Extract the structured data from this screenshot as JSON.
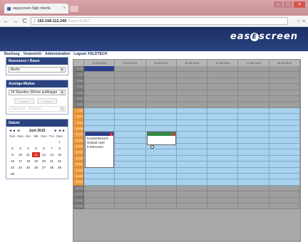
{
  "browser": {
    "tab_title": "easyscreen Sign Interfa",
    "tab_close": "×",
    "url_host": "192.168.112.240",
    "url_path": "/easyLEXEC",
    "win_min": "–",
    "win_max": "□",
    "win_close": "×",
    "back_icon": "←",
    "forward_icon": "→",
    "reload_icon": "C",
    "menu_icon": "☆ ≡"
  },
  "app": {
    "logo_left": "eas",
    "logo_badge": "E",
    "logo_right": "screen",
    "nav": [
      "Buchung",
      "Voransicht",
      "Administration",
      "Logout: FELDTECH"
    ]
  },
  "sidebar": {
    "resource": {
      "title": "Ressource / Raum",
      "value": "Berlin"
    },
    "display": {
      "title": "Anzeige-Modus",
      "value": "24 Stunden (60min aufklappe",
      "btn1": "Laden",
      "btn2": "Zurück",
      "secondary": "Standard - Wochen"
    },
    "date": {
      "title": "Datum",
      "prev": "◄◄ ◄",
      "month": "Juni 2015",
      "next": "► ►►",
      "weekdays": [
        "Son",
        "Mon",
        "Die",
        "Mit",
        "Don",
        "Fre",
        "Sam"
      ],
      "days": [
        "",
        "",
        "",
        "",
        "",
        "",
        "1",
        "2",
        "3",
        "4",
        "5",
        "6",
        "7",
        "8",
        "9",
        "10",
        "11",
        "12",
        "13",
        "14",
        "15",
        "16",
        "17",
        "18",
        "19",
        "20",
        "21",
        "22",
        "23",
        "24",
        "25",
        "26",
        "27",
        "28",
        "29",
        "30",
        "",
        "",
        "",
        "",
        "",
        ""
      ],
      "selected_day": "12"
    }
  },
  "schedule": {
    "dates": [
      "12.06.2015",
      "13.06.2015",
      "14.06.2015",
      "15.06.2015",
      "16.06.2015",
      "17.06.2015",
      "18.06.2015"
    ],
    "hours": [
      "0:00",
      "1:00",
      "2:00",
      "3:00",
      "4:00",
      "5:00",
      "6:00",
      "7:00",
      "8:00",
      "9:00",
      "10:00",
      "11:00",
      "12:00",
      "13:00",
      "14:00",
      "15:00",
      "16:00",
      "17:00",
      "18:00",
      "19:00",
      "20:00",
      "21:00",
      "22:00",
      "23:00"
    ],
    "business_hours_start": 7,
    "business_hours_end": 19,
    "bookings": [
      {
        "day": 0,
        "label": "Kundenbesuch",
        "extra": "Default User\n5 Personen",
        "head_color": "#2b3d8c"
      },
      {
        "day": 2,
        "label": "",
        "extra": "",
        "head_color": "#2e8b47"
      }
    ]
  }
}
